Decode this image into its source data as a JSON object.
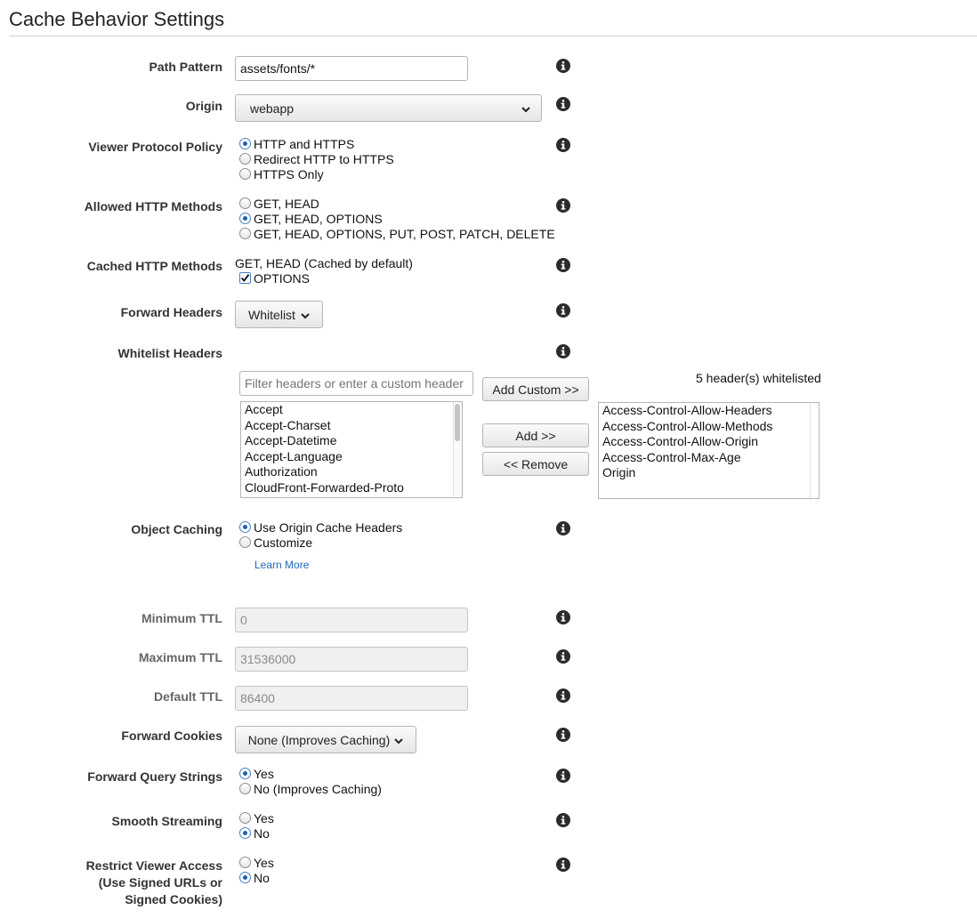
{
  "page": {
    "title": "Cache Behavior Settings"
  },
  "path_pattern": {
    "label": "Path Pattern",
    "value": "assets/fonts/*"
  },
  "origin": {
    "label": "Origin",
    "value": "webapp"
  },
  "viewer_protocol_policy": {
    "label": "Viewer Protocol Policy",
    "options": [
      "HTTP and HTTPS",
      "Redirect HTTP to HTTPS",
      "HTTPS Only"
    ],
    "selected": 0
  },
  "allowed_http_methods": {
    "label": "Allowed HTTP Methods",
    "options": [
      "GET, HEAD",
      "GET, HEAD, OPTIONS",
      "GET, HEAD, OPTIONS, PUT, POST, PATCH, DELETE"
    ],
    "selected": 1
  },
  "cached_http_methods": {
    "label": "Cached HTTP Methods",
    "default_text": "GET, HEAD (Cached by default)",
    "options_label": "OPTIONS",
    "options_checked": true
  },
  "forward_headers": {
    "label": "Forward Headers",
    "value": "Whitelist"
  },
  "whitelist_headers": {
    "label": "Whitelist Headers",
    "filter_placeholder": "Filter headers or enter a custom header",
    "add_custom_label": "Add Custom >>",
    "add_label": "Add >>",
    "remove_label": "<< Remove",
    "count_text": "5 header(s) whitelisted",
    "available": [
      "Accept",
      "Accept-Charset",
      "Accept-Datetime",
      "Accept-Language",
      "Authorization",
      "CloudFront-Forwarded-Proto"
    ],
    "whitelisted": [
      "Access-Control-Allow-Headers",
      "Access-Control-Allow-Methods",
      "Access-Control-Allow-Origin",
      "Access-Control-Max-Age",
      "Origin"
    ]
  },
  "object_caching": {
    "label": "Object Caching",
    "options": [
      "Use Origin Cache Headers",
      "Customize"
    ],
    "selected": 0,
    "learn_more": "Learn More"
  },
  "minimum_ttl": {
    "label": "Minimum TTL",
    "value": "0"
  },
  "maximum_ttl": {
    "label": "Maximum TTL",
    "value": "31536000"
  },
  "default_ttl": {
    "label": "Default TTL",
    "value": "86400"
  },
  "forward_cookies": {
    "label": "Forward Cookies",
    "value": "None (Improves Caching)"
  },
  "forward_query_strings": {
    "label": "Forward Query Strings",
    "options": [
      "Yes",
      "No (Improves Caching)"
    ],
    "selected": 0
  },
  "smooth_streaming": {
    "label": "Smooth Streaming",
    "options": [
      "Yes",
      "No"
    ],
    "selected": 1
  },
  "restrict_viewer_access": {
    "label_lines": [
      "Restrict Viewer Access",
      "(Use Signed URLs or",
      "Signed Cookies)"
    ],
    "options": [
      "Yes",
      "No"
    ],
    "selected": 1
  },
  "icons": {
    "info": "info-icon",
    "chevron": "chevron-down-icon",
    "check": "checkmark-icon"
  },
  "colors": {
    "link": "#1d66b8",
    "radio_selected": "#1f5fb3",
    "info_icon": "#2b2b2b"
  }
}
